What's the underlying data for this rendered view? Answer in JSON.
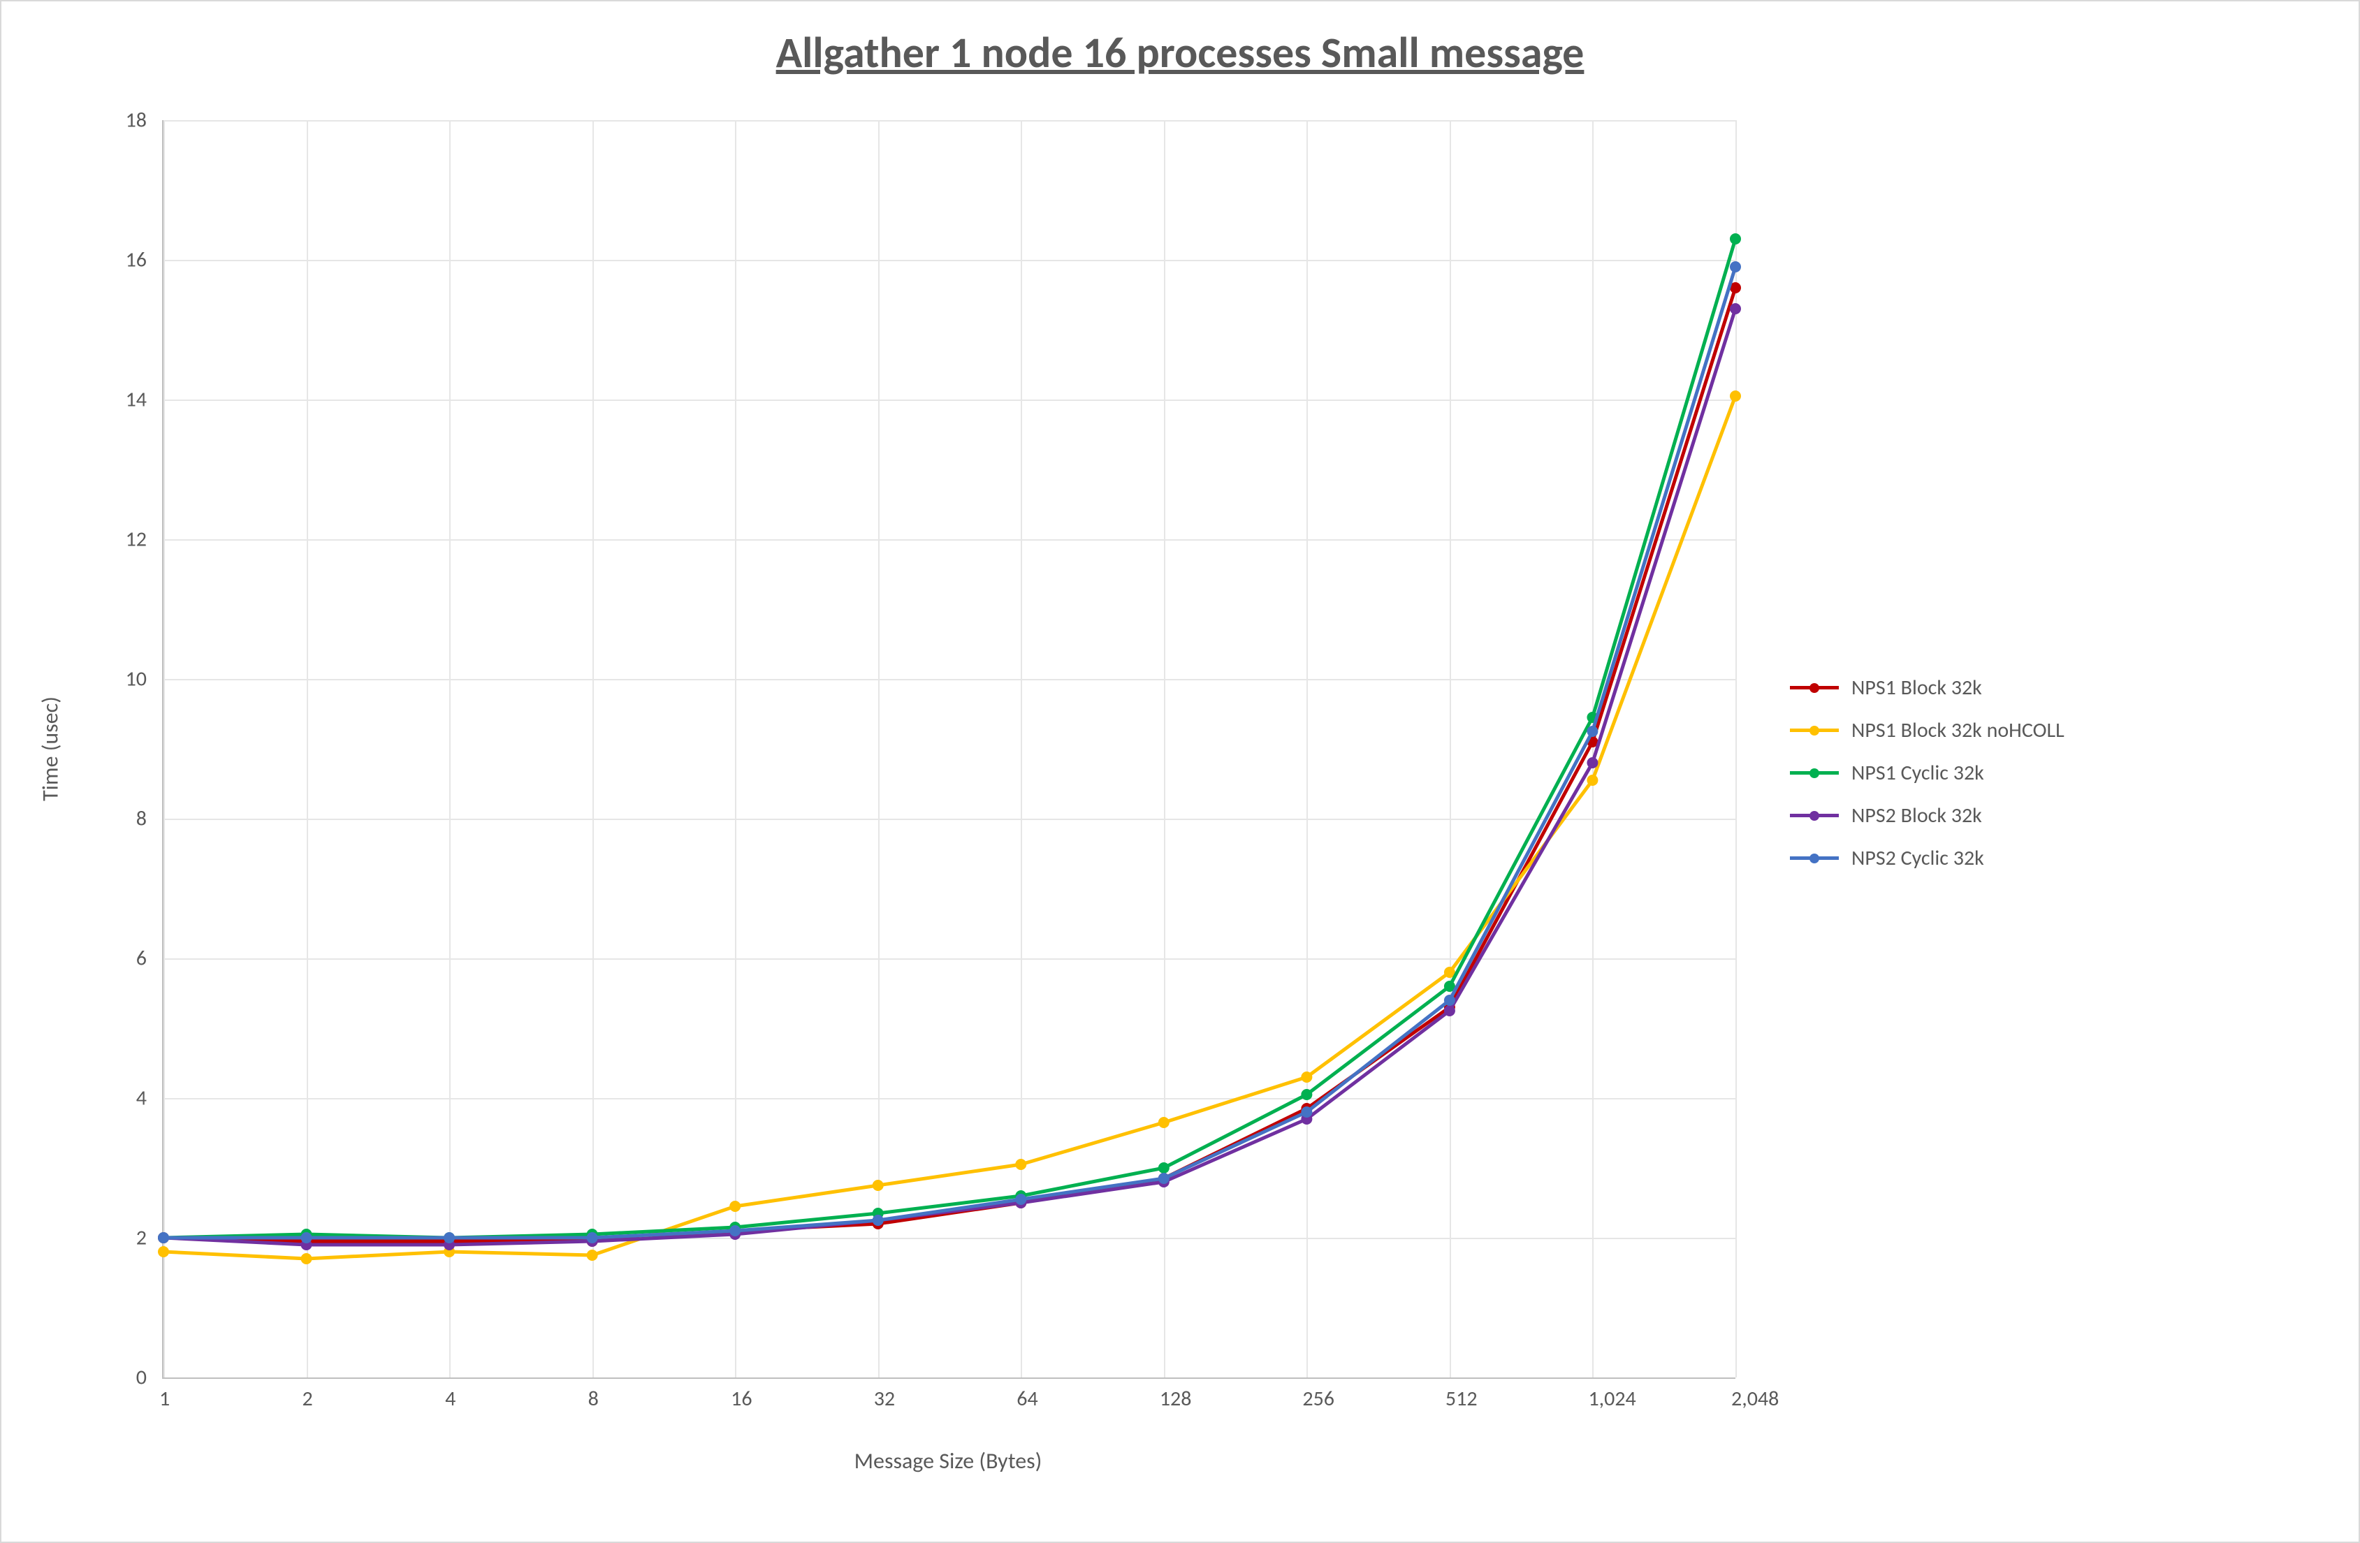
{
  "chart_data": {
    "type": "line",
    "title": "Allgather 1 node 16 processes Small message",
    "xlabel": "Message Size (Bytes)",
    "ylabel": "Time (usec)",
    "x_scale": "log2_categorical",
    "categories": [
      "1",
      "2",
      "4",
      "8",
      "16",
      "32",
      "64",
      "128",
      "256",
      "512",
      "1,024",
      "2,048"
    ],
    "ylim": [
      0,
      18
    ],
    "yticks": [
      0,
      2,
      4,
      6,
      8,
      10,
      12,
      14,
      16,
      18
    ],
    "series": [
      {
        "name": "NPS1 Block 32k",
        "color": "#C00000",
        "values": [
          2.0,
          1.95,
          1.95,
          1.95,
          2.1,
          2.2,
          2.5,
          2.85,
          3.85,
          5.3,
          9.1,
          15.6
        ]
      },
      {
        "name": "NPS1 Block 32k noHCOLL",
        "color": "#FFC000",
        "values": [
          1.8,
          1.7,
          1.8,
          1.75,
          2.45,
          2.75,
          3.05,
          3.65,
          4.3,
          5.8,
          8.55,
          14.05
        ]
      },
      {
        "name": "NPS1 Cyclic 32k",
        "color": "#00B050",
        "values": [
          2.0,
          2.05,
          2.0,
          2.05,
          2.15,
          2.35,
          2.6,
          3.0,
          4.05,
          5.6,
          9.45,
          16.3
        ]
      },
      {
        "name": "NPS2 Block 32k",
        "color": "#7030A0",
        "values": [
          2.0,
          1.9,
          1.9,
          1.95,
          2.05,
          2.25,
          2.5,
          2.8,
          3.7,
          5.25,
          8.8,
          15.3
        ]
      },
      {
        "name": "NPS2 Cyclic 32k",
        "color": "#4472C4",
        "values": [
          2.0,
          2.0,
          2.0,
          2.0,
          2.1,
          2.25,
          2.55,
          2.85,
          3.8,
          5.4,
          9.25,
          15.9
        ]
      }
    ],
    "legend_position": "right",
    "grid": true
  }
}
